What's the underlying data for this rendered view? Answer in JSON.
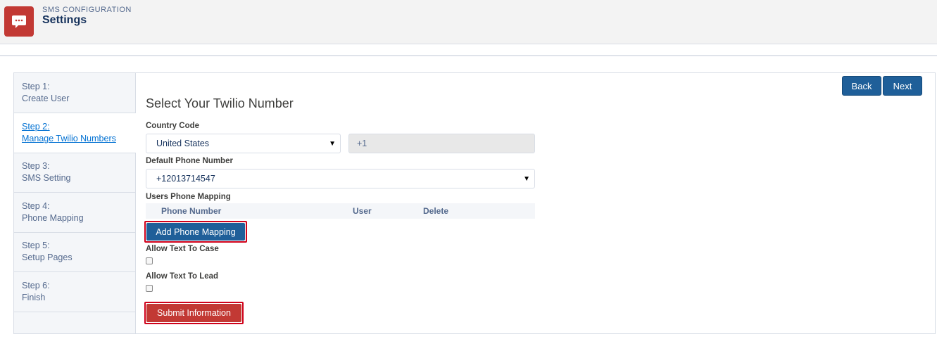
{
  "header": {
    "kicker": "SMS CONFIGURATION",
    "title": "Settings",
    "icon": "chat-bubble-icon",
    "icon_color": "#c23934"
  },
  "steps": [
    {
      "step": "Step 1:",
      "label": "Create User",
      "active": false
    },
    {
      "step": "Step 2:",
      "label": "Manage Twilio Numbers",
      "active": true
    },
    {
      "step": "Step 3:",
      "label": "SMS Setting",
      "active": false
    },
    {
      "step": "Step 4:",
      "label": "Phone Mapping",
      "active": false
    },
    {
      "step": "Step 5:",
      "label": "Setup Pages",
      "active": false
    },
    {
      "step": "Step 6:",
      "label": "Finish",
      "active": false
    }
  ],
  "nav": {
    "back_label": "Back",
    "next_label": "Next"
  },
  "form": {
    "title": "Select Your Twilio Number",
    "country_code_label": "Country Code",
    "country_value": "United States",
    "country_dial_code": "+1",
    "default_phone_label": "Default Phone Number",
    "default_phone_value": "+12013714547",
    "users_mapping_label": "Users Phone Mapping",
    "table_columns": [
      "Phone Number",
      "User",
      "Delete"
    ],
    "add_mapping_label": "Add Phone Mapping",
    "allow_case_label": "Allow Text To Case",
    "allow_lead_label": "Allow Text To Lead",
    "submit_label": "Submit Information"
  },
  "colors": {
    "primary": "#1f5f99",
    "danger": "#c23934",
    "highlight": "#d0021b"
  }
}
